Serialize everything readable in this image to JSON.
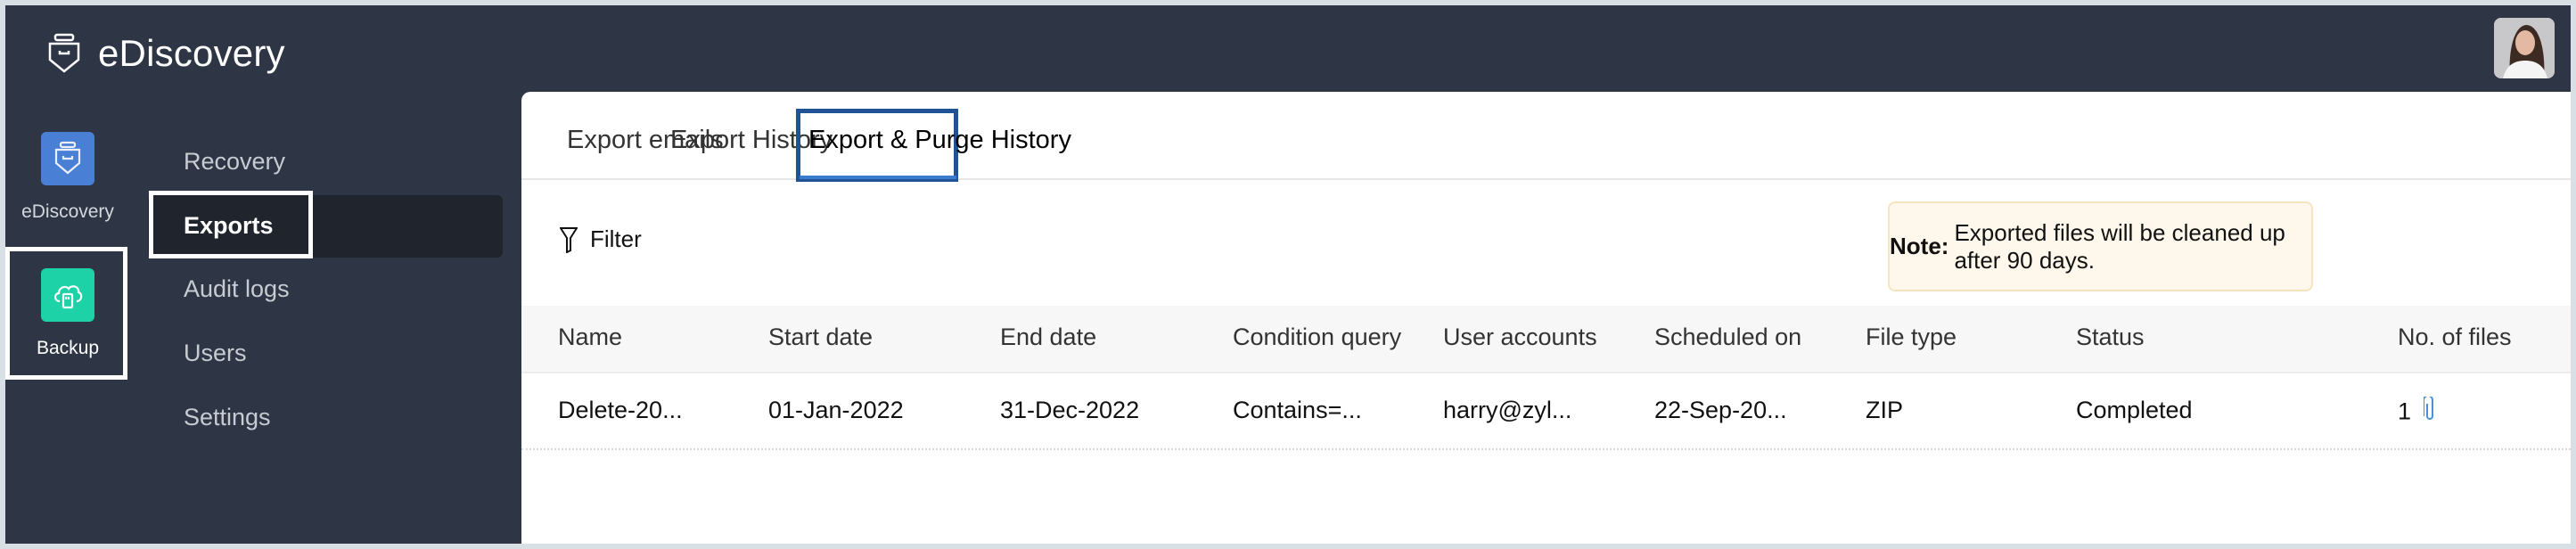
{
  "app": {
    "title": "eDiscovery"
  },
  "header": {
    "avatar_alt": "user-avatar"
  },
  "rail": {
    "items": [
      {
        "label": "eDiscovery",
        "icon": "ediscovery-icon",
        "color": "#4a7fd6"
      },
      {
        "label": "Backup",
        "icon": "cloud-backup-icon",
        "color": "#1dd2a6",
        "highlighted": true
      }
    ]
  },
  "nav": {
    "items": [
      {
        "label": "Recovery"
      },
      {
        "label": "Exports",
        "active": true
      },
      {
        "label": "Audit logs"
      },
      {
        "label": "Users"
      },
      {
        "label": "Settings"
      }
    ]
  },
  "tabs": [
    {
      "label": "Export emails"
    },
    {
      "label": "Export History"
    },
    {
      "label": "Export & Purge History",
      "active": true
    }
  ],
  "toolbar": {
    "filter_label": "Filter"
  },
  "note": {
    "bold": "Note:",
    "text": "Exported files will be cleaned up after 90 days."
  },
  "table": {
    "columns": [
      "Name",
      "Start date",
      "End date",
      "Condition query",
      "User accounts",
      "Scheduled on",
      "File type",
      "Status",
      "No. of files"
    ],
    "rows": [
      [
        "Delete-20...",
        "01-Jan-2022",
        "31-Dec-2022",
        "Contains=...",
        "harry@zyl...",
        "22-Sep-20...",
        "ZIP",
        "Completed",
        "1"
      ]
    ]
  },
  "colors": {
    "accent": "#1f5393",
    "attachment": "#4a90d9",
    "sidebar": "#2e3645"
  }
}
